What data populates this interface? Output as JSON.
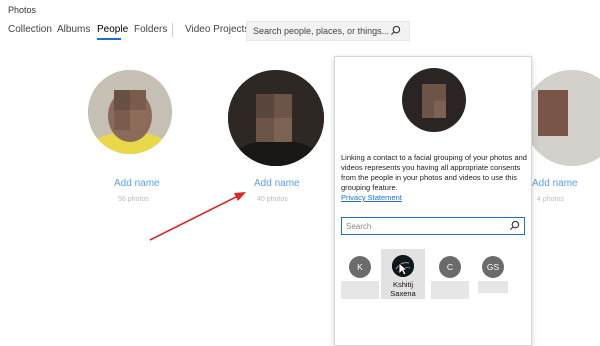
{
  "app": {
    "title": "Photos"
  },
  "nav": {
    "tabs": [
      {
        "label": "Collection"
      },
      {
        "label": "Albums"
      },
      {
        "label": "People"
      },
      {
        "label": "Folders"
      },
      {
        "label": "Video Projects"
      }
    ],
    "active_tab": "People",
    "search_placeholder": "Search people, places, or things..."
  },
  "people": [
    {
      "add_label": "Add name",
      "count": "56 photos"
    },
    {
      "add_label": "Add name",
      "count": "40 photos"
    },
    {
      "add_label": "Add name",
      "count": "4 photos"
    }
  ],
  "flyout": {
    "description": "Linking a contact to a facial grouping of your photos and videos represents you having all appropriate consents from the people in your photos and videos to use this grouping feature.",
    "privacy_link": "Privacy Statement",
    "search_placeholder": "Search",
    "contacts": [
      {
        "initials": "K",
        "name": ""
      },
      {
        "initials": "",
        "name": "Kshitij Saxena",
        "selected": true
      },
      {
        "initials": "C",
        "name": ""
      },
      {
        "initials": "GS",
        "name": ""
      }
    ]
  },
  "colors": {
    "accent": "#1a73c9",
    "add_name": "#5aa0e6",
    "arrow": "#d62a2a"
  }
}
